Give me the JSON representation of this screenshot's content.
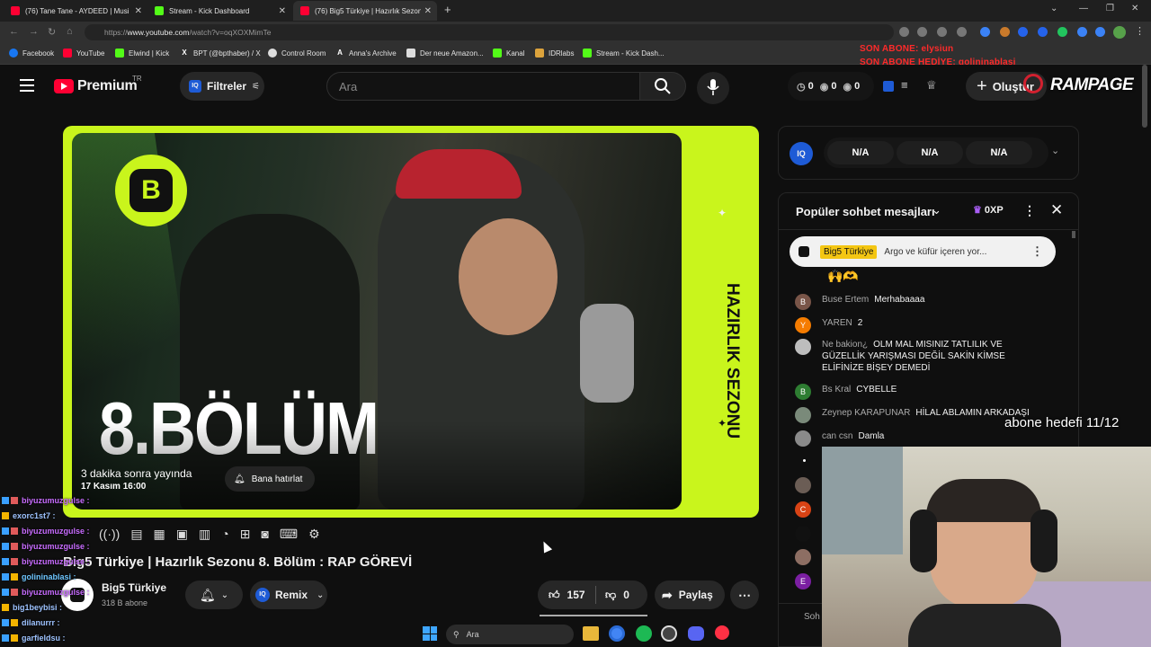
{
  "browser": {
    "tabs": [
      {
        "title": "(76) Tane Tane - AYDEED | Musi",
        "favicon_color": "#ff0033"
      },
      {
        "title": "Stream - Kick Dashboard",
        "favicon_color": "#53fc18"
      },
      {
        "title": "(76) Big5 Türkiye | Hazırlık Sezon",
        "favicon_color": "#ff0033"
      }
    ],
    "url_prefix": "https://",
    "url_host": "www.youtube.com",
    "url_path": "/watch?v=oqXOXMimTe",
    "bookmarks": [
      "Facebook",
      "YouTube",
      "Elwind | Kick",
      "BPT (@bpthaber) / X",
      "Control Room",
      "Anna's Archive",
      "Der neue Amazon...",
      "Kanal",
      "IDRlabs",
      "Stream - Kick Dash..."
    ]
  },
  "stream_overlay": {
    "banner_line1": "SON ABONE: elysiun",
    "banner_line2": "SON ABONE HEDİYE: golininablasi",
    "logo": "RAMPAGE",
    "sub_goal": "abone hedefi 11/12"
  },
  "youtube": {
    "logo": "Premium",
    "region": "TR",
    "filter_label": "Filtreler",
    "search_placeholder": "Ara",
    "counters": [
      "0",
      "0",
      "0"
    ],
    "create_label": "Oluştur",
    "video": {
      "episode_text": "8.BÖLÜM",
      "vertical_text": "HAZIRLIK SEZONU",
      "premiere_text": "3 dakika sonra yayında",
      "premiere_date": "17 Kasım 16:00",
      "remind_label": "Bana hatırlat",
      "title": "Big5 Türkiye | Hazırlık Sezonu 8. Bölüm : RAP GÖREVİ"
    },
    "channel": {
      "name": "Big5 Türkiye",
      "subs": "318 B abone"
    },
    "remix_label": "Remix",
    "likes": "157",
    "dislikes": "0",
    "share_label": "Paylaş"
  },
  "popular_bar": {
    "values": [
      "N/A",
      "N/A",
      "N/A"
    ]
  },
  "chat": {
    "header": "Popüler sohbet mesajları",
    "xp": "0XP",
    "pinned_author": "Big5 Türkiye",
    "pinned_text": "Argo ve küfür içeren yor...",
    "messages": [
      {
        "initial": "B",
        "color": "#795548",
        "author": "Buse Ertem",
        "text": "Merhabaaaa"
      },
      {
        "initial": "Y",
        "color": "#f57c00",
        "author": "YAREN",
        "text": "2"
      },
      {
        "initial": "",
        "color": "#bdbdbd",
        "author": "Ne bakion¿",
        "text": "OLM MAL MISINIZ TATLILIK VE GÜZELLİK YARIŞMASI DEĞİL SAKİN KİMSE ELİFİNİZE BİŞEY DEMEDİ"
      },
      {
        "initial": "B",
        "color": "#2e7d32",
        "author": "Bs Kral",
        "text": "CYBELLE"
      },
      {
        "initial": "",
        "color": "#7a8a7a",
        "author": "Zeynep KARAPUNAR",
        "text": "HİLAL ABLAMIN ARKADAŞI"
      },
      {
        "initial": "",
        "color": "#8a8a8a",
        "author": "can csn",
        "text": "Damla"
      }
    ],
    "lower_avatars": [
      {
        "initial": "C",
        "color": "#d84315"
      },
      {
        "initial": "E",
        "color": "#7b1fa2"
      }
    ],
    "input_hint": "Soh"
  },
  "overlay_chat": [
    {
      "user": "biyuzumuzgulse :",
      "color": "#c86cff"
    },
    {
      "user": "exorc1st7 :",
      "color": "#9ec3ff"
    },
    {
      "user": "biyuzumuzgulse :",
      "color": "#c86cff"
    },
    {
      "user": "biyuzumuzgulse :",
      "color": "#c86cff"
    },
    {
      "user": "biyuzumuzgulse :",
      "color": "#c86cff"
    },
    {
      "user": "golininablasi :",
      "color": "#6ec6ff"
    },
    {
      "user": "biyuzumuzgulse :",
      "color": "#c86cff"
    },
    {
      "user": "big1beybisi :",
      "color": "#9ec3ff"
    },
    {
      "user": "dilanurrr :",
      "color": "#9ec3ff"
    },
    {
      "user": "garfieldsu :",
      "color": "#9ec3ff"
    }
  ],
  "taskbar": {
    "search_label": "Ara"
  }
}
